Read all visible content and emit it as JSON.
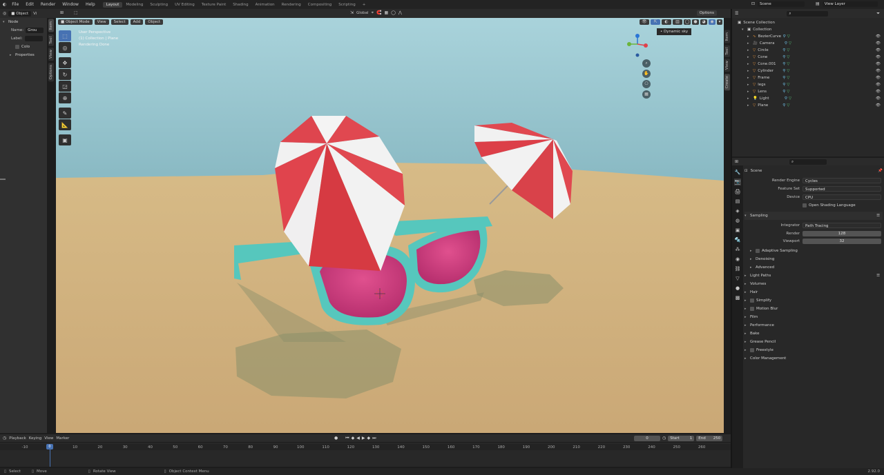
{
  "menubar": {
    "items": [
      "File",
      "Edit",
      "Render",
      "Window",
      "Help"
    ],
    "workspaces": [
      "Layout",
      "Modeling",
      "Sculpting",
      "UV Editing",
      "Texture Paint",
      "Shading",
      "Animation",
      "Rendering",
      "Compositing",
      "Scripting"
    ],
    "active_workspace": "Layout",
    "add_tab": "+",
    "scene": "Scene",
    "view_layer": "View Layer"
  },
  "left_header": {
    "mode": "Object",
    "extra": "Vi"
  },
  "node_panel": {
    "title": "Node",
    "name_label": "Name:",
    "name_value": "Grou",
    "label_label": "Label:",
    "color_label": "Colo",
    "properties_label": "Properties",
    "tabs": [
      "Item",
      "Tool",
      "View",
      "Options"
    ]
  },
  "viewport": {
    "mode": "Object Mode",
    "menus": [
      "View",
      "Select",
      "Add",
      "Object"
    ],
    "overlay_lines": [
      "User Perspective",
      "(1) Collection | Plane",
      "Rendering Done"
    ],
    "transform": "Global",
    "options": "Options",
    "hdri_label": "Dynamic sky",
    "n_tabs": [
      "Item",
      "Tool",
      "View",
      "Create"
    ]
  },
  "outliner": {
    "scene_collection": "Scene Collection",
    "collection": "Collection",
    "items": [
      "BezierCurve",
      "Camera",
      "Circle",
      "Cone",
      "Cone.001",
      "Cylinder",
      "Frame",
      "legs",
      "Lens",
      "Light",
      "Plane"
    ]
  },
  "properties": {
    "breadcrumb": "Scene",
    "render_engine_label": "Render Engine",
    "render_engine": "Cycles",
    "feature_set_label": "Feature Set",
    "feature_set": "Supported",
    "device_label": "Device",
    "device": "CPU",
    "osl": "Open Shading Language",
    "sampling": "Sampling",
    "integrator_label": "Integrator",
    "integrator": "Path Tracing",
    "render_label": "Render",
    "render_samples": "128",
    "viewport_label": "Viewport",
    "viewport_samples": "32",
    "sub_sections": [
      "Adaptive Sampling",
      "Denoising",
      "Advanced"
    ],
    "sections": [
      "Light Paths",
      "Volumes",
      "Hair",
      "Simplify",
      "Motion Blur",
      "Film",
      "Performance",
      "Bake",
      "Grease Pencil",
      "Freestyle",
      "Color Management"
    ]
  },
  "timeline": {
    "menus": [
      "Playback",
      "Keying",
      "View",
      "Marker"
    ],
    "current_frame": "0",
    "start_label": "Start",
    "start": "1",
    "end_label": "End",
    "end": "250",
    "ticks": [
      "-10",
      "0",
      "10",
      "20",
      "30",
      "40",
      "50",
      "60",
      "70",
      "80",
      "90",
      "100",
      "110",
      "120",
      "130",
      "140",
      "150",
      "160",
      "170",
      "180",
      "190",
      "200",
      "210",
      "220",
      "230",
      "240",
      "250",
      "260"
    ]
  },
  "statusbar": {
    "select": "Select",
    "move": "Move",
    "rotate": "Rotate View",
    "context": "Object Context Menu",
    "version": "2.92.0"
  },
  "colors": {
    "accent": "#4772b3",
    "bg": "#1d1d1d",
    "header": "#2b2b2b"
  }
}
